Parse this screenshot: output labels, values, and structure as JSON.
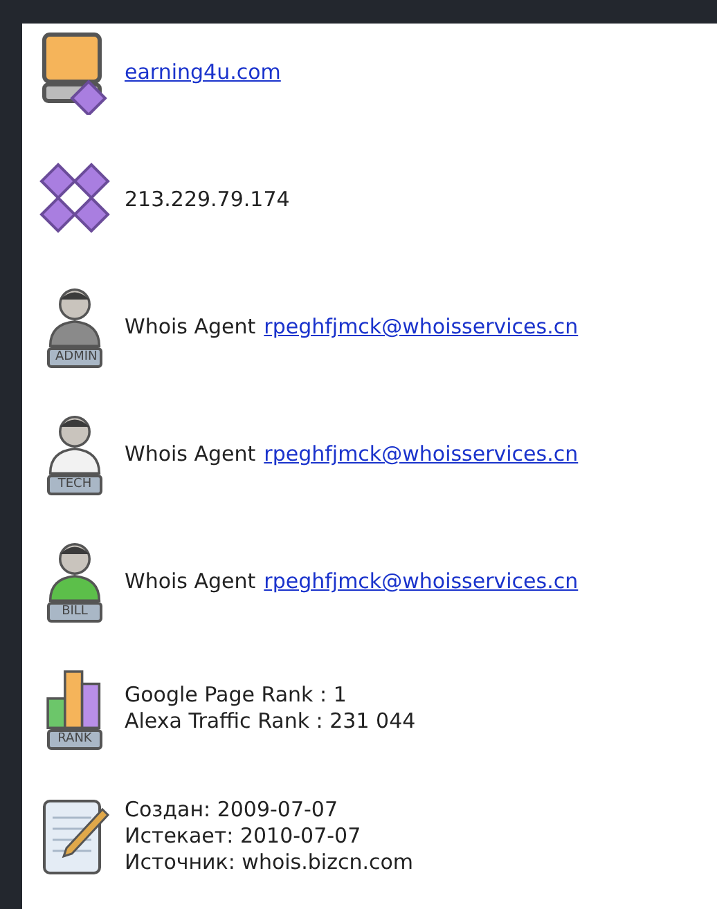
{
  "rows": [
    {
      "kind": "domain",
      "link": "earning4u.com"
    },
    {
      "kind": "ip",
      "text": "213.229.79.174"
    },
    {
      "kind": "contact",
      "badge": "ADMIN",
      "color": "#8a8a8a",
      "label": "Whois Agent",
      "email": "rpeghfjmck@whoisservices.cn"
    },
    {
      "kind": "contact",
      "badge": "TECH",
      "color": "#f2f2f2",
      "label": "Whois Agent",
      "email": "rpeghfjmck@whoisservices.cn"
    },
    {
      "kind": "contact",
      "badge": "BILL",
      "color": "#5cbf4a",
      "label": "Whois Agent",
      "email": "rpeghfjmck@whoisservices.cn"
    },
    {
      "kind": "rank",
      "badge": "RANK",
      "lines": [
        "Google Page Rank : 1",
        "Alexa Traffic Rank : 231 044"
      ]
    },
    {
      "kind": "dates",
      "lines": [
        "Создан: 2009-07-07",
        "Истекает: 2010-07-07",
        "Источник: whois.bizcn.com"
      ]
    }
  ]
}
